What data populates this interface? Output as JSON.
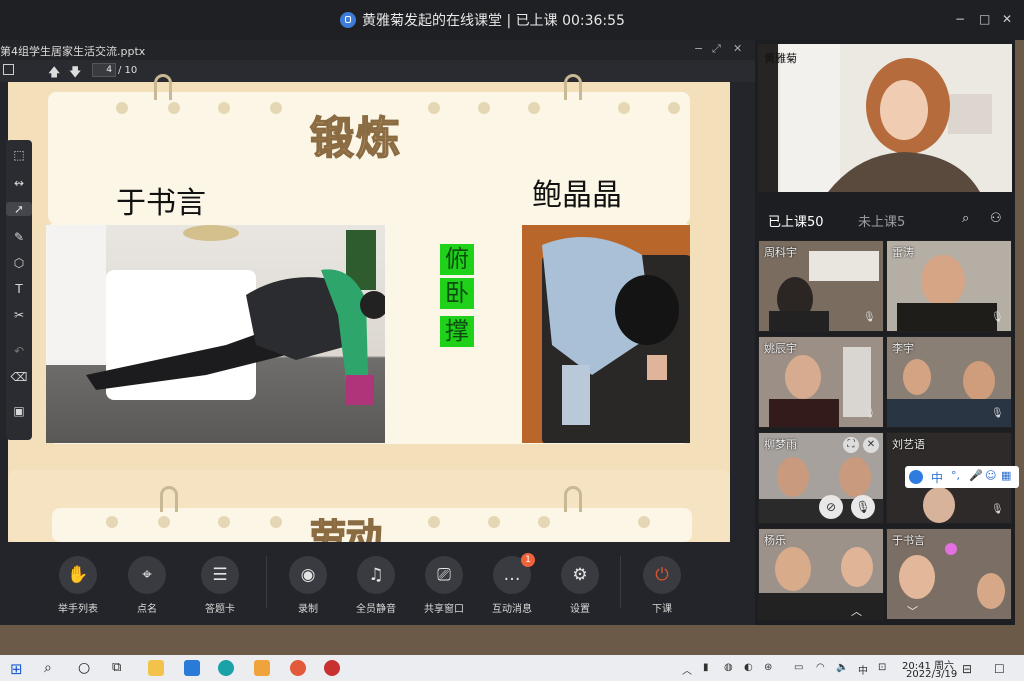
{
  "window": {
    "title": "黄雅菊发起的在线课堂 | 已上课 00:36:55",
    "controls": [
      "−",
      "□",
      "✕"
    ]
  },
  "document": {
    "filename": "第4组学生居家生活交流.pptx",
    "current_page": "4",
    "total_pages": "/ 10"
  },
  "slide": {
    "title": "锻炼",
    "left_name": "于书言",
    "right_name": "鲍晶晶",
    "activity_chars": [
      "俯",
      "卧",
      "撑"
    ],
    "next_title_partial": "劳动"
  },
  "bottom_toolbar": [
    {
      "label": "举手列表",
      "icon": "hand-icon"
    },
    {
      "label": "点名",
      "icon": "location-pin-icon"
    },
    {
      "label": "答题卡",
      "icon": "answer-card-icon"
    },
    {
      "label": "录制",
      "icon": "record-icon"
    },
    {
      "label": "全员静音",
      "icon": "mute-all-icon"
    },
    {
      "label": "共享窗口",
      "icon": "share-window-icon"
    },
    {
      "label": "互动消息",
      "icon": "chat-icon",
      "badge": "1"
    },
    {
      "label": "设置",
      "icon": "gear-icon"
    },
    {
      "label": "下课",
      "icon": "power-icon"
    }
  ],
  "teacher": {
    "name": "黄雅菊"
  },
  "tabs": {
    "attended": "已上课50",
    "absent": "未上课5"
  },
  "participants": [
    {
      "name": "周科宇"
    },
    {
      "name": "雷涛"
    },
    {
      "name": "姚辰宇"
    },
    {
      "name": "李宇"
    },
    {
      "name": "柳梦雨"
    },
    {
      "name": "刘艺语"
    },
    {
      "name": "杨乐"
    },
    {
      "name": "于书言"
    }
  ],
  "ime": {
    "label": "中"
  },
  "taskbar": {
    "time": "20:41 周六",
    "date": "2022/3/19",
    "tray_lang": "中"
  },
  "colors": {
    "accent_green": "#1fd219",
    "badge_orange": "#f0623a",
    "power_red": "#e0552c",
    "title_brown": "#8a6b42"
  }
}
